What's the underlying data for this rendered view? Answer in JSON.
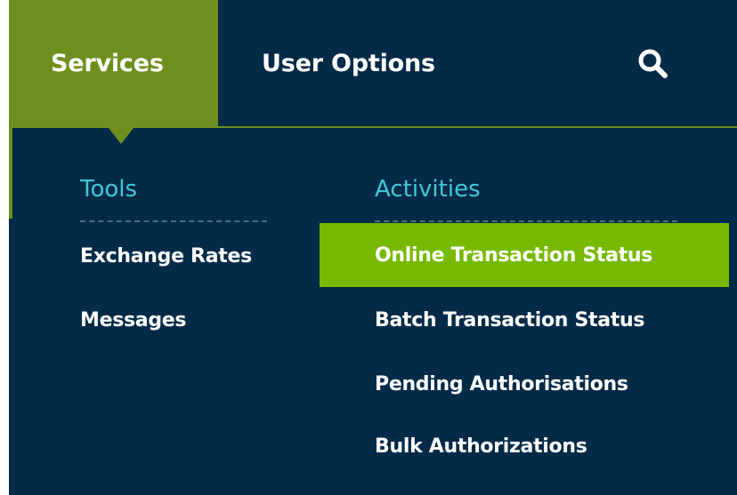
{
  "nav": {
    "services_label": "Services",
    "user_options_label": "User Options",
    "search_icon": "search-icon"
  },
  "tools": {
    "heading": "Tools",
    "items": [
      {
        "label": "Exchange Rates"
      },
      {
        "label": "Messages"
      }
    ]
  },
  "activities": {
    "heading": "Activities",
    "items": [
      {
        "label": "Online Transaction Status",
        "highlighted": true
      },
      {
        "label": "Batch Transaction Status"
      },
      {
        "label": "Pending Authorisations"
      },
      {
        "label": "Bulk Authorizations"
      }
    ]
  },
  "colors": {
    "navy": "#032a47",
    "olive_green": "#6e8f1e",
    "highlight_green": "#76b900",
    "heading_cyan": "#3ec9d6",
    "text_white": "#ffffff"
  }
}
